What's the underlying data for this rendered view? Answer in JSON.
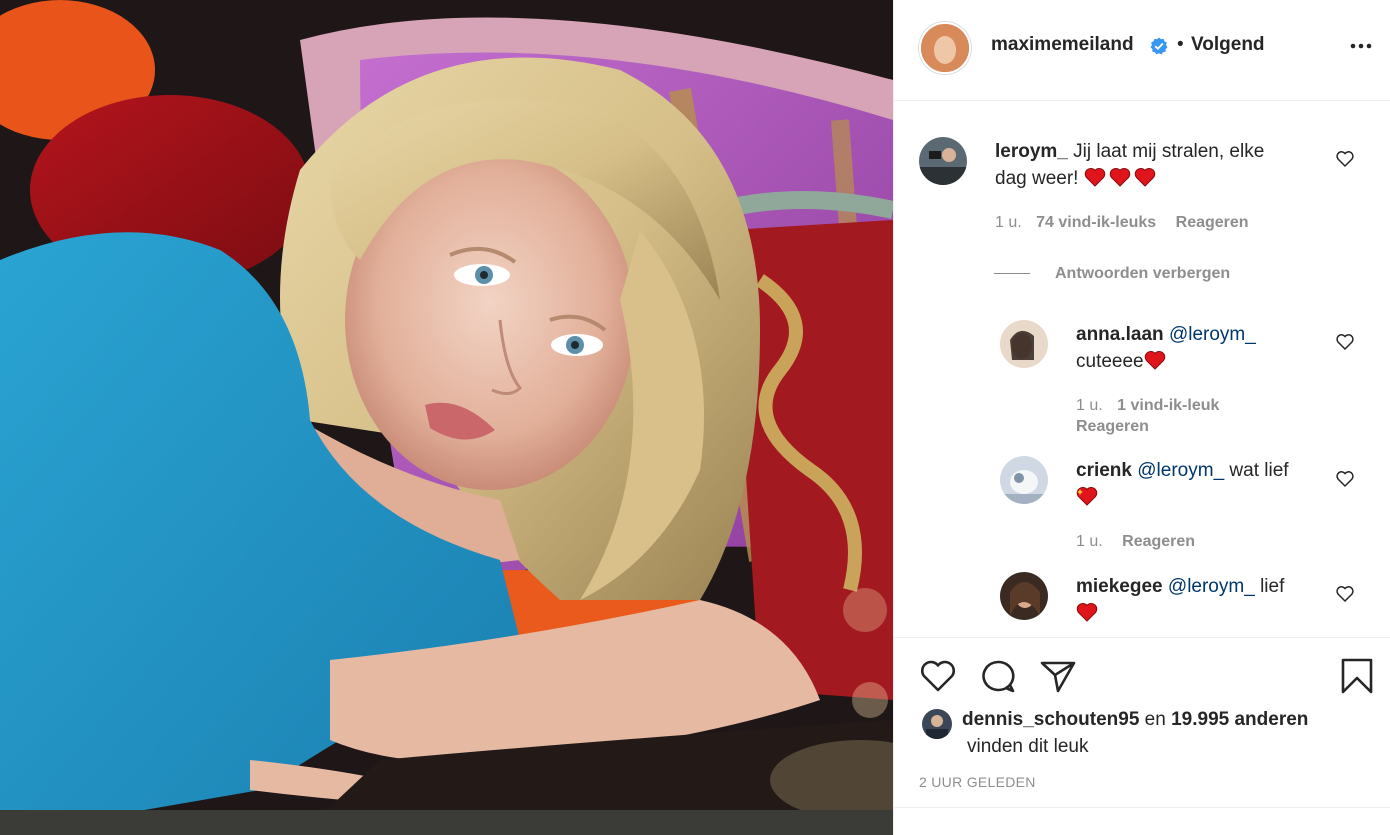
{
  "post": {
    "username": "maximemeiland",
    "follow_separator": "•",
    "follow_status": "Volgend",
    "more_icon": "more-horizontal-icon",
    "verified_color": "#3897f0"
  },
  "comments": [
    {
      "username": "leroym_",
      "text": "Jij laat mij stralen, elke",
      "text_line2": "dag weer!",
      "emojis": [
        "red-heart",
        "red-heart",
        "red-heart"
      ],
      "time": "1 u.",
      "likes": "74 vind-ik-leuks",
      "reply": "Reageren",
      "toggle_replies": "Antwoorden verbergen"
    }
  ],
  "replies": [
    {
      "username": "anna.laan",
      "mention": "@leroym_",
      "text": "cuteeee",
      "emojis": [
        "red-heart"
      ],
      "time": "1 u.",
      "likes": "1 vind-ik-leuk",
      "reply": "Reageren"
    },
    {
      "username": "crienk",
      "mention": "@leroym_",
      "text": "wat lief",
      "emojis": [
        "sparkling-heart"
      ],
      "time": "1 u.",
      "reply": "Reageren"
    },
    {
      "username": "miekegee",
      "mention": "@leroym_",
      "text": "lief",
      "emojis": [
        "red-heart"
      ]
    }
  ],
  "likes": {
    "liker": "dennis_schouten95",
    "connector": "en",
    "others": "19.995 anderen",
    "suffix": "vinden dit leuk"
  },
  "timestamp": "2 UUR GELEDEN",
  "colors": {
    "text": "#262626",
    "muted": "#8e8e8e",
    "mention": "#00376b",
    "heart_red": "#e0151b"
  }
}
